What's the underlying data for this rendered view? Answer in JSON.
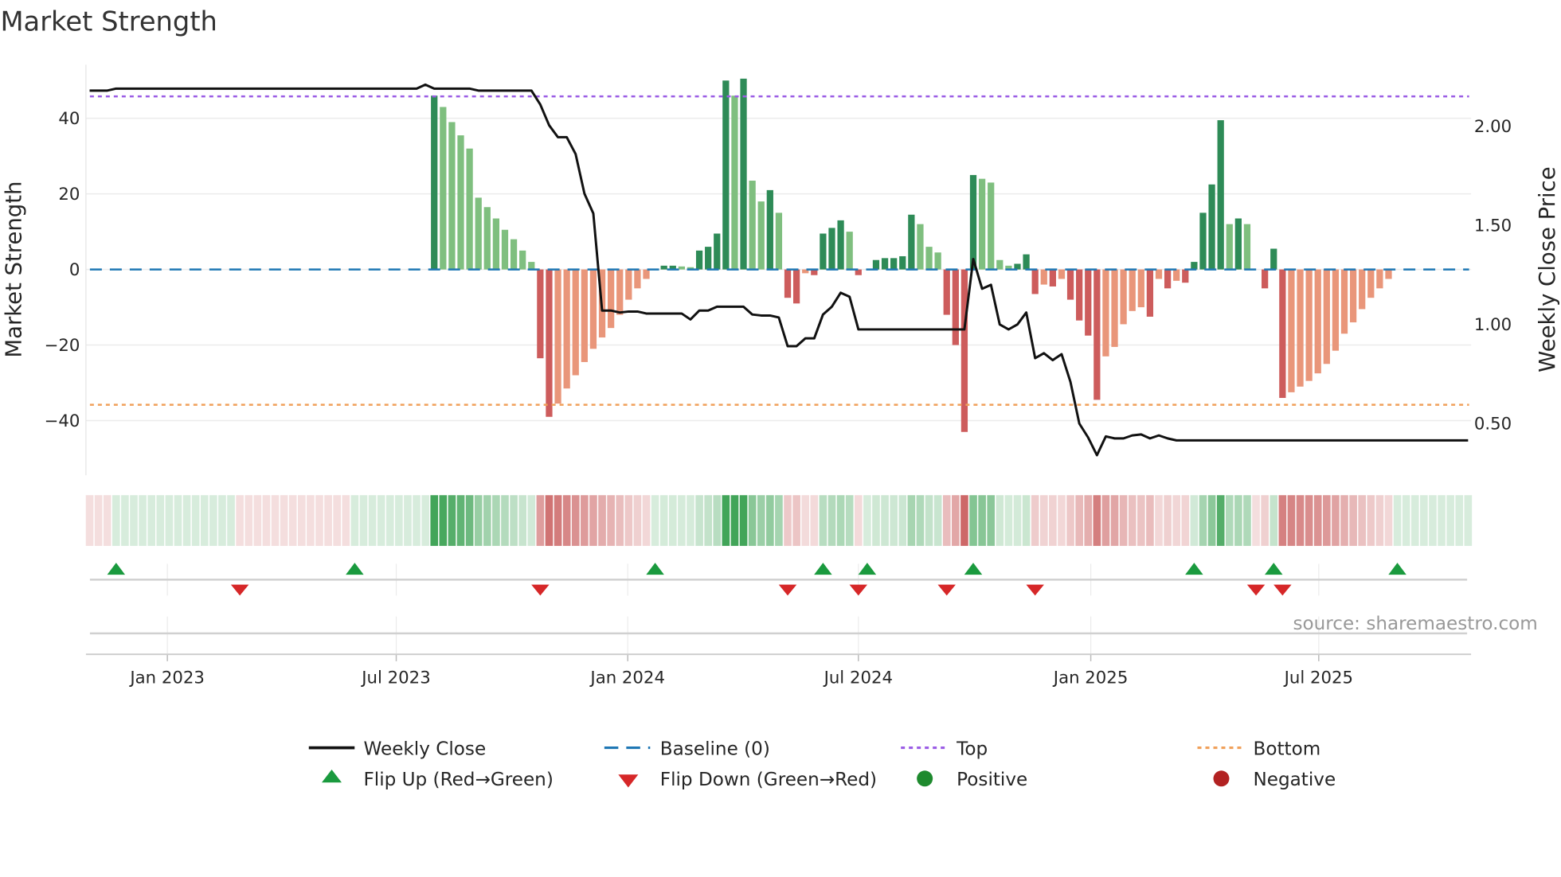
{
  "chart_data": {
    "type": "bar",
    "title": "Market Strength",
    "ylabel": "Market Strength",
    "y2label": "Weekly Close Price",
    "ylim": [
      -55,
      55
    ],
    "y2lim": [
      0.28,
      2.21
    ],
    "x_unit": "week index",
    "xticks": [
      {
        "week": 8.8,
        "label": "Jan 2023"
      },
      {
        "week": 34.7,
        "label": "Jul 2023"
      },
      {
        "week": 60.9,
        "label": "Jan 2024"
      },
      {
        "week": 87.0,
        "label": "Jul 2024"
      },
      {
        "week": 113.3,
        "label": "Jan 2025"
      },
      {
        "week": 139.1,
        "label": "Jul 2025"
      }
    ],
    "yticks": [
      {
        "value": 40,
        "label": "40"
      },
      {
        "value": 20,
        "label": "20"
      },
      {
        "value": 0,
        "label": "0"
      },
      {
        "value": -20,
        "label": "−20"
      },
      {
        "value": -40,
        "label": "−40"
      }
    ],
    "y2ticks": [
      {
        "value": 2.0,
        "label": "2.00"
      },
      {
        "value": 1.5,
        "label": "1.50"
      },
      {
        "value": 1.0,
        "label": "1.00"
      },
      {
        "value": 0.5,
        "label": "0.50"
      }
    ],
    "top_level": 45.8,
    "bottom_level": -35.8,
    "baseline": 0,
    "strength": [
      0,
      0,
      0,
      0,
      0,
      0,
      0,
      0,
      0,
      0,
      0,
      0,
      0,
      0,
      0,
      0,
      0,
      0,
      0,
      0,
      0,
      0,
      0,
      0,
      0,
      0,
      0,
      0,
      0,
      0,
      0,
      0,
      0,
      0,
      0,
      0,
      0,
      0,
      0,
      46,
      43,
      39,
      35.5,
      32,
      19,
      16.5,
      13.5,
      10.5,
      8,
      5,
      2,
      -23.5,
      -39,
      -35.5,
      -31.5,
      -28,
      -24.5,
      -21,
      -18,
      -15.5,
      -12,
      -8,
      -5,
      -2.5,
      0,
      1,
      1,
      0.8,
      0.6,
      5,
      6,
      9.5,
      50,
      46,
      50.5,
      23.5,
      18,
      21,
      15,
      -7.5,
      -9,
      -1,
      -1.5,
      9.5,
      11,
      13,
      10,
      -1.5,
      0,
      2.5,
      3,
      3,
      3.5,
      14.5,
      12,
      6,
      4.5,
      -12,
      -20,
      -43,
      25,
      24,
      23,
      2.5,
      1,
      1.5,
      4,
      -6.5,
      -4,
      -4.5,
      -2.5,
      -8,
      -13.5,
      -17.5,
      -34.5,
      -23,
      -20.5,
      -14.5,
      -11,
      -10,
      -12.5,
      -2.5,
      -5,
      -3,
      -3.5,
      2,
      15,
      22.5,
      39.5,
      12,
      13.5,
      12,
      0,
      -5,
      5.5,
      -34,
      -32.5,
      -31,
      -29.5,
      -27.5,
      -25,
      -21.5,
      -17,
      -14,
      -10.5,
      -7.5,
      -5,
      -2.5,
      0,
      0,
      0,
      0,
      0,
      0,
      0,
      0,
      0
    ],
    "weekly_close": [
      2.18,
      2.18,
      2.18,
      2.19,
      2.19,
      2.19,
      2.19,
      2.19,
      2.19,
      2.19,
      2.19,
      2.19,
      2.19,
      2.19,
      2.19,
      2.19,
      2.19,
      2.19,
      2.19,
      2.19,
      2.19,
      2.19,
      2.19,
      2.19,
      2.19,
      2.19,
      2.19,
      2.19,
      2.19,
      2.19,
      2.19,
      2.19,
      2.19,
      2.19,
      2.19,
      2.19,
      2.19,
      2.19,
      2.21,
      2.19,
      2.19,
      2.19,
      2.19,
      2.19,
      2.18,
      2.18,
      2.18,
      2.18,
      2.18,
      2.18,
      2.18,
      2.11,
      2.005,
      1.945,
      1.945,
      1.86,
      1.66,
      1.56,
      1.07,
      1.07,
      1.06,
      1.065,
      1.065,
      1.055,
      1.055,
      1.055,
      1.055,
      1.055,
      1.025,
      1.07,
      1.07,
      1.09,
      1.09,
      1.09,
      1.09,
      1.05,
      1.045,
      1.045,
      1.035,
      0.89,
      0.89,
      0.93,
      0.93,
      1.05,
      1.09,
      1.16,
      1.14,
      0.975,
      0.975,
      0.975,
      0.975,
      0.975,
      0.975,
      0.975,
      0.975,
      0.975,
      0.975,
      0.975,
      0.975,
      0.975,
      1.33,
      1.18,
      1.2,
      1.0,
      0.975,
      1.0,
      1.06,
      0.83,
      0.855,
      0.82,
      0.85,
      0.71,
      0.5,
      0.43,
      0.34,
      0.435,
      0.425,
      0.425,
      0.44,
      0.445,
      0.425,
      0.44,
      0.425,
      0.415,
      0.415,
      0.415,
      0.415,
      0.415,
      0.415,
      0.415,
      0.415,
      0.415,
      0.415,
      0.415,
      0.415,
      0.415,
      0.415,
      0.415,
      0.415,
      0.415,
      0.415,
      0.415,
      0.415,
      0.415,
      0.415,
      0.415,
      0.415,
      0.415,
      0.415,
      0.415,
      0.415,
      0.415,
      0.415,
      0.415,
      0.415,
      0.415,
      0.415
    ],
    "regime_runs": [
      [
        -1,
        3
      ],
      [
        1,
        14
      ],
      [
        -1,
        13
      ],
      [
        1,
        21
      ],
      [
        -1,
        13
      ],
      [
        1,
        15
      ],
      [
        -1,
        4
      ],
      [
        1,
        4
      ],
      [
        -1,
        1
      ],
      [
        1,
        9
      ],
      [
        -1,
        3
      ],
      [
        1,
        7
      ],
      [
        -1,
        18
      ],
      [
        1,
        7
      ],
      [
        -1,
        2
      ],
      [
        1,
        1
      ],
      [
        -1,
        13
      ],
      [
        1,
        9
      ]
    ],
    "flip_up_weeks": [
      3,
      30,
      64,
      83,
      88,
      100,
      125,
      134,
      148
    ],
    "flip_down_weeks": [
      17,
      51,
      79,
      87,
      97,
      107,
      132,
      135
    ],
    "legend_placement": "bottom-center",
    "legend": {
      "weekly_close": "Weekly Close",
      "baseline": "Baseline (0)",
      "top": "Top",
      "bottom": "Bottom",
      "flip_up": "Flip Up (Red→Green)",
      "flip_down": "Flip Down (Green→Red)",
      "positive": "Positive",
      "negative": "Negative"
    },
    "source": "source: sharemaestro.com"
  },
  "colors": {
    "strong_pos": "#2e8b57",
    "weak_pos": "#7fbf7f",
    "strong_neg": "#cd5c5c",
    "weak_neg": "#e9967a",
    "baseline": "#1f77b4",
    "top": "#9b5de5",
    "bottom": "#f0a05a",
    "close": "#111111",
    "flip_up": "#1a9a3e",
    "flip_down": "#d62728",
    "positive": "#1e8a2e",
    "negative": "#b22222"
  }
}
